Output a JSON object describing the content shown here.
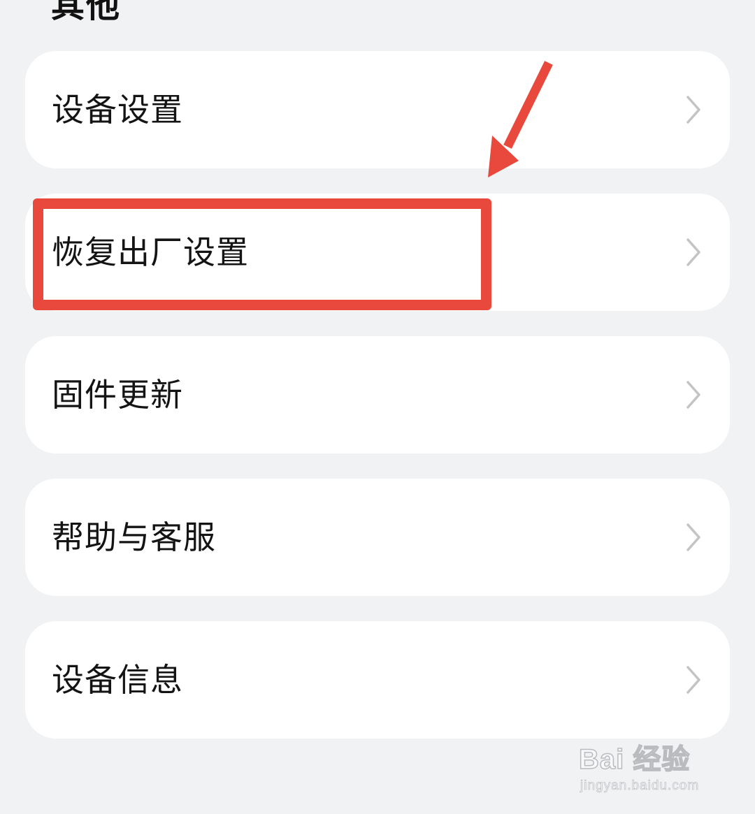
{
  "section": {
    "title": "其他"
  },
  "menu": {
    "items": [
      {
        "label": "设备设置",
        "icon": "chevron-right-icon"
      },
      {
        "label": "恢复出厂设置",
        "icon": "chevron-right-icon"
      },
      {
        "label": "固件更新",
        "icon": "chevron-right-icon"
      },
      {
        "label": "帮助与客服",
        "icon": "chevron-right-icon"
      },
      {
        "label": "设备信息",
        "icon": "chevron-right-icon"
      }
    ]
  },
  "annotation": {
    "highlight_color": "#e8493c",
    "highlighted_item": "恢复出厂设置"
  },
  "watermark": {
    "brand": "Bai 经验",
    "url": "jingyan.baidu.com"
  },
  "colors": {
    "background": "#f1f2f4",
    "card": "#ffffff",
    "text": "#141414",
    "chevron": "#c4c4c6"
  }
}
